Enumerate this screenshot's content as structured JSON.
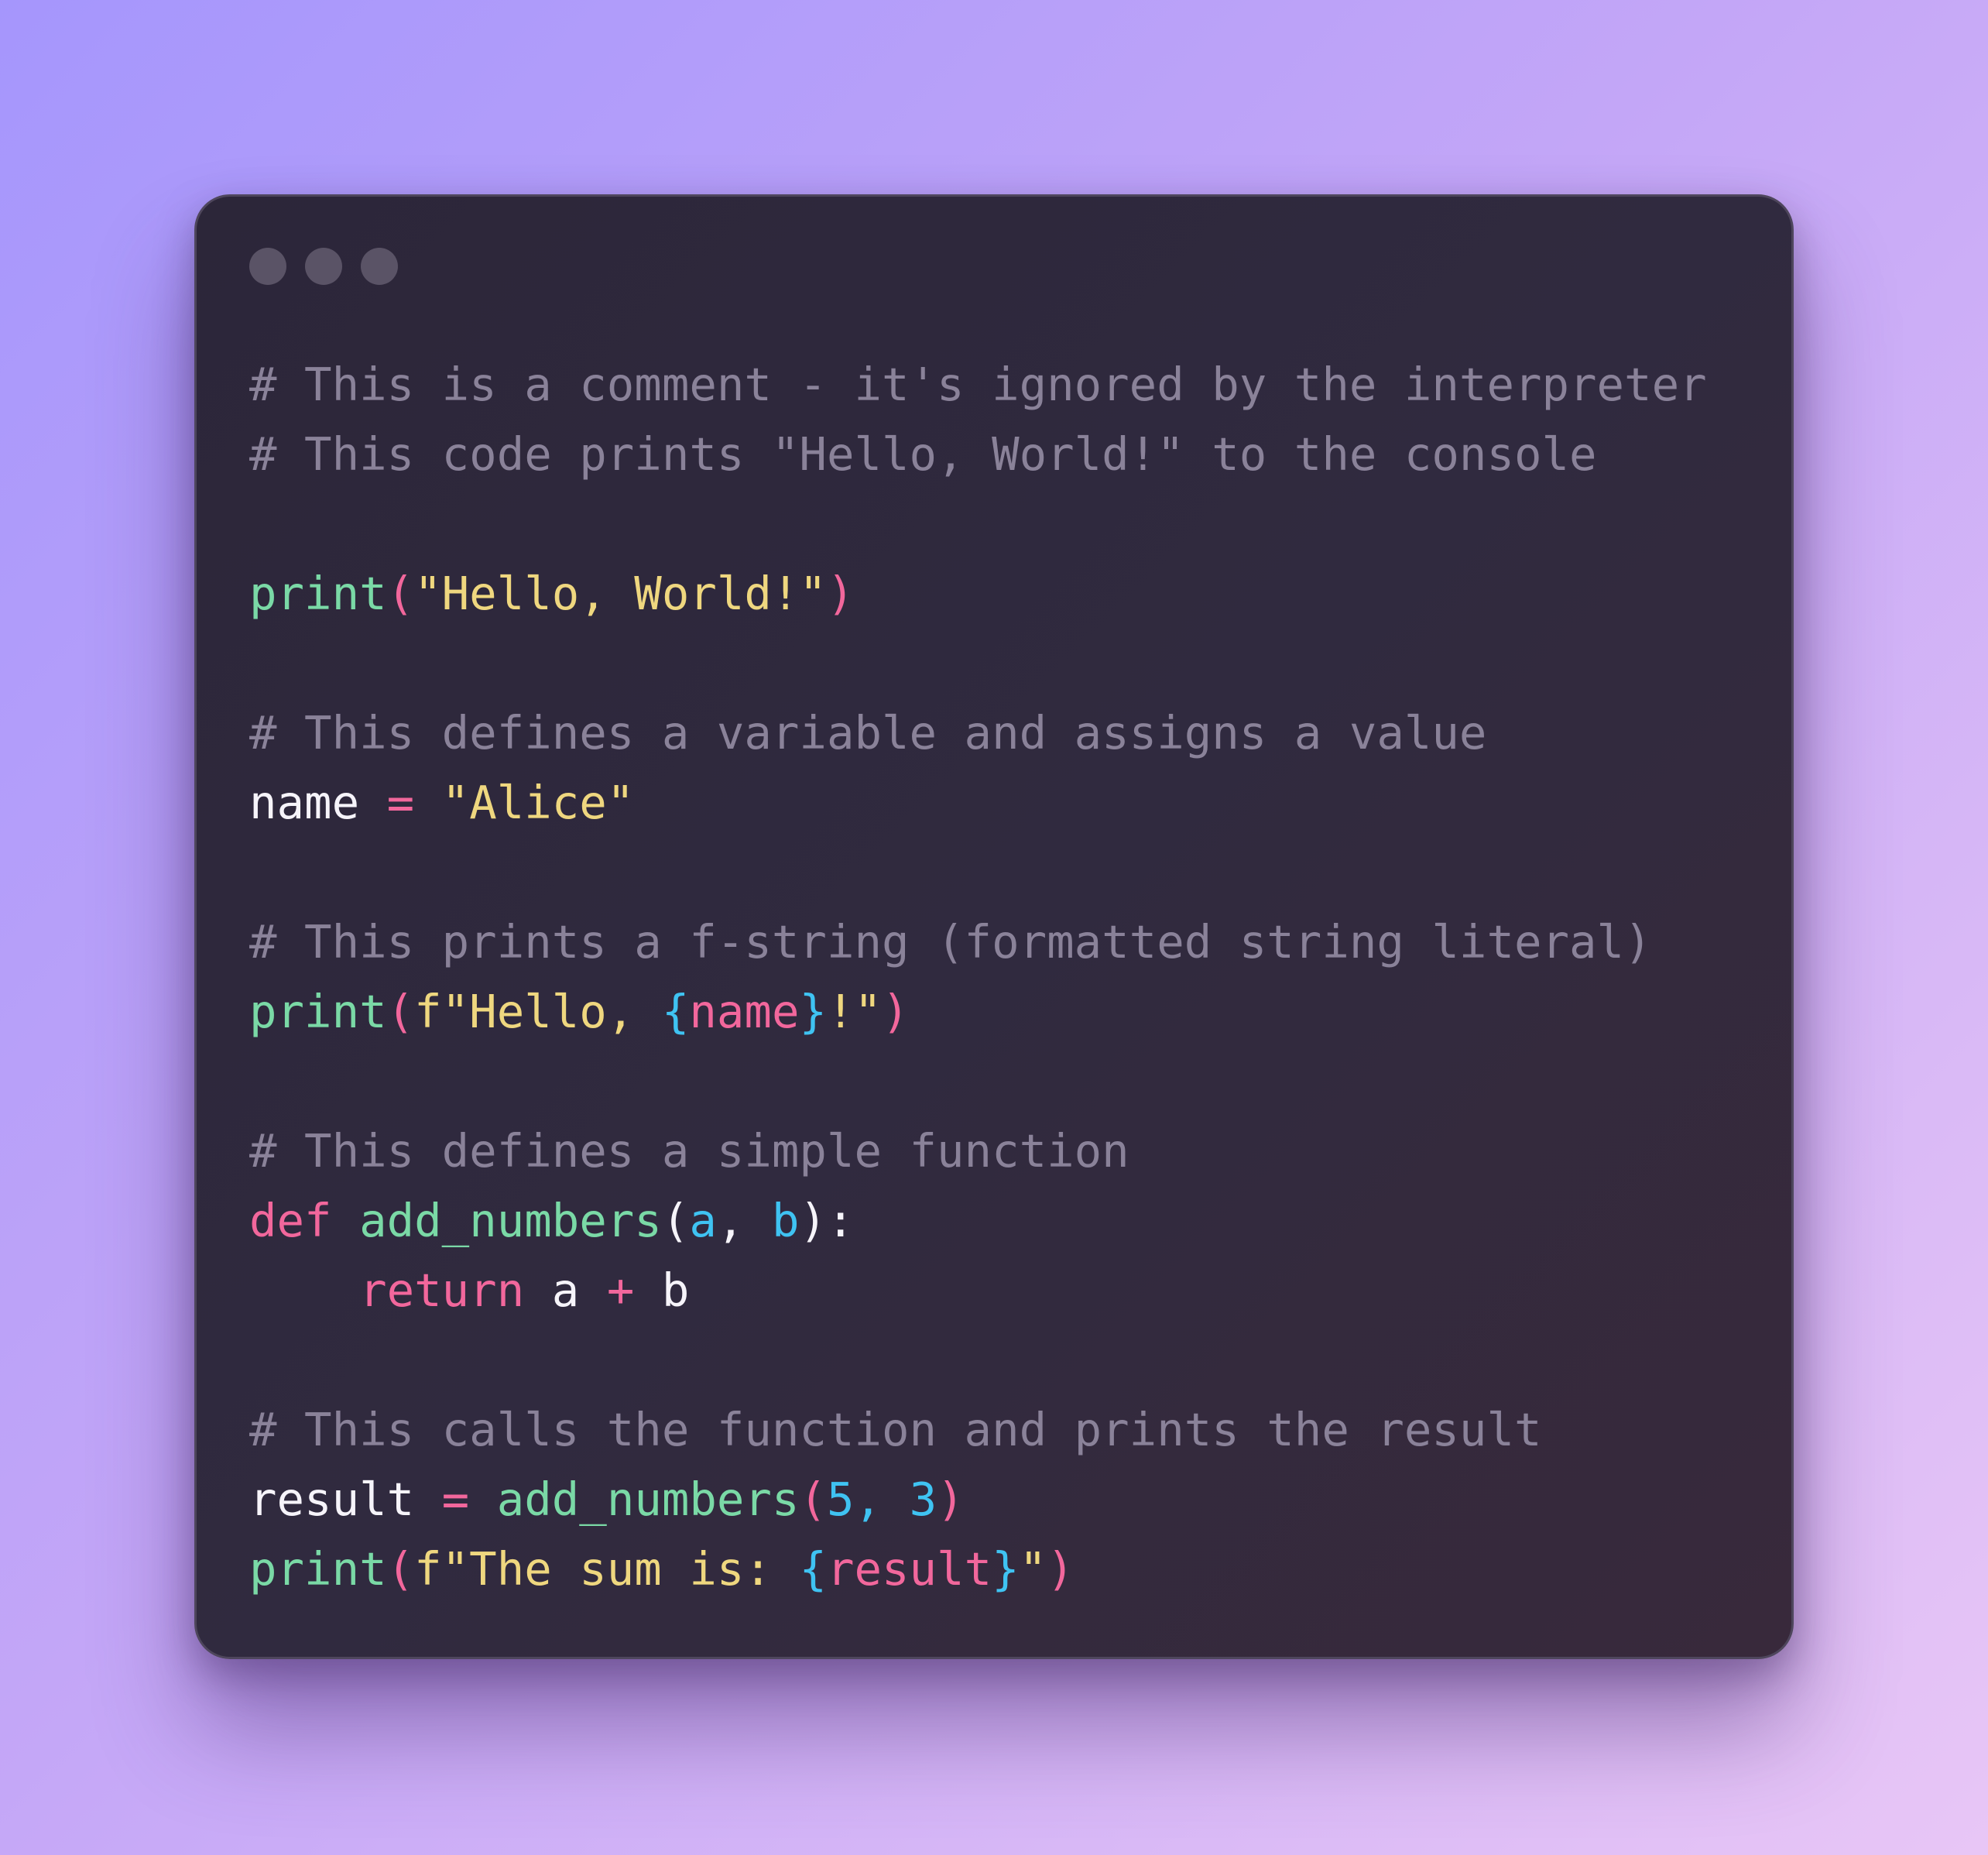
{
  "window": {
    "traffic_lights": [
      "close",
      "minimize",
      "maximize"
    ]
  },
  "code": {
    "line1": "# This is a comment - it's ignored by the interpreter",
    "line2": "# This code prints \"Hello, World!\" to the console",
    "line4": {
      "func": "print",
      "open": "(",
      "str": "\"Hello, World!\"",
      "close": ")"
    },
    "line6": "# This defines a variable and assigns a value",
    "line7": {
      "var": "name",
      "op": "=",
      "str": "\"Alice\""
    },
    "line9": "# This prints a f-string (formatted string literal)",
    "line10": {
      "func": "print",
      "open": "(",
      "str_start": "f\"Hello, ",
      "brace_open": "{",
      "interp": "name",
      "brace_close": "}",
      "str_end": "!\"",
      "close": ")"
    },
    "line12": "# This defines a simple function",
    "line13": {
      "keyword": "def",
      "func": "add_numbers",
      "open": "(",
      "param_a": "a",
      "comma": ",",
      "param_b": "b",
      "close": "):"
    },
    "line14": {
      "indent": "    ",
      "keyword": "return",
      "a": "a",
      "op": "+",
      "b": "b"
    },
    "line16": "# This calls the function and prints the result",
    "line17": {
      "var": "result",
      "op": "=",
      "func": "add_numbers",
      "open": "(",
      "num1": "5",
      "comma": ",",
      "num2": "3",
      "close": ")"
    },
    "line18": {
      "func": "print",
      "open": "(",
      "str_start": "f\"The sum is: ",
      "brace_open": "{",
      "interp": "result",
      "brace_close": "}",
      "str_end": "\"",
      "close": ")"
    }
  },
  "colors": {
    "comment": "#8a8299",
    "function": "#7ad9a6",
    "keyword": "#f2679c",
    "string": "#efd77f",
    "parameter": "#3fc3f2",
    "number": "#3fc3f2",
    "text": "#f6f4fa",
    "window_bg": "#2e2839",
    "traffic_light": "#5a5366"
  }
}
